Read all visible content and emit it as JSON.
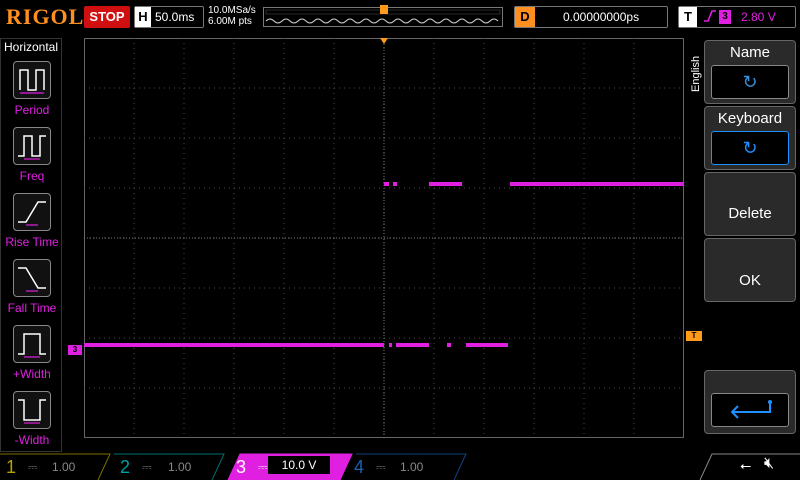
{
  "header": {
    "logo": "RIGOL",
    "run_state": "STOP",
    "timebase_letter": "H",
    "timebase": "50.0ms",
    "sample_rate": "10.0MSa/s",
    "mem_depth": "6.00M pts",
    "delay_letter": "D",
    "delay": "0.00000000ps",
    "trigger_letter": "T",
    "trigger_source": "3",
    "trigger_edge": "rising",
    "trigger_level": "2.80 V"
  },
  "left_menu": {
    "title": "Horizontal",
    "items": [
      {
        "label": "Period",
        "icon": "period-icon"
      },
      {
        "label": "Freq",
        "icon": "freq-icon"
      },
      {
        "label": "Rise Time",
        "icon": "rise-time-icon"
      },
      {
        "label": "Fall Time",
        "icon": "fall-time-icon"
      },
      {
        "label": "+Width",
        "icon": "positive-width-icon"
      },
      {
        "label": "-Width",
        "icon": "negative-width-icon"
      }
    ]
  },
  "right_menu": {
    "language": "English",
    "buttons": [
      {
        "label": "Name",
        "icon": "undo-icon"
      },
      {
        "label": "Keyboard",
        "icon": "undo-icon"
      },
      {
        "label": "Delete"
      },
      {
        "label": "OK"
      },
      {
        "icon": "enter-icon"
      }
    ]
  },
  "channels": [
    {
      "number": "1",
      "scale": "1.00 V",
      "color": "#f0e000",
      "active": false
    },
    {
      "number": "2",
      "scale": "1.00 V",
      "color": "#00e0e0",
      "active": false
    },
    {
      "number": "3",
      "scale": "10.0 V",
      "color": "#e020e0",
      "active": true
    },
    {
      "number": "4",
      "scale": "1.00 V",
      "color": "#2a7fff",
      "active": false
    }
  ],
  "markers": {
    "ch3_ground": "3",
    "trigger_level": "T"
  },
  "colors": {
    "trace": "#e020e0",
    "grid": "#4a4a4a",
    "accent": "#ff8f1f",
    "stop": "#d01010"
  },
  "status_icons": [
    "usb-icon",
    "speaker-muted-icon"
  ]
}
